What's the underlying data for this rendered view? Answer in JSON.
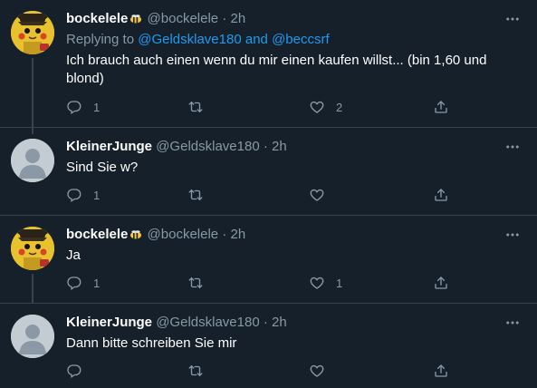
{
  "tweets": [
    {
      "name": "bockelele",
      "handle": "@bockelele",
      "time": "2h",
      "replying_prefix": "Replying to ",
      "replying_user1": "@Geldsklave180",
      "replying_and": " and ",
      "replying_user2": "@beccsrf",
      "text": "Ich brauch auch einen wenn du mir einen kaufen willst... (bin 1,60 und blond)",
      "reply_count": "1",
      "retweet_count": "",
      "like_count": "2"
    },
    {
      "name": "KleinerJunge",
      "handle": "@Geldsklave180",
      "time": "2h",
      "text": "Sind Sie w?",
      "reply_count": "1",
      "retweet_count": "",
      "like_count": ""
    },
    {
      "name": "bockelele",
      "handle": "@bockelele",
      "time": "2h",
      "text": "Ja",
      "reply_count": "1",
      "retweet_count": "",
      "like_count": "1"
    },
    {
      "name": "KleinerJunge",
      "handle": "@Geldsklave180",
      "time": "2h",
      "text": "Dann bitte schreiben Sie mir",
      "reply_count": "",
      "retweet_count": "",
      "like_count": ""
    }
  ],
  "separator": "·",
  "icons": {
    "reply": "reply-icon",
    "retweet": "retweet-icon",
    "like": "heart-icon",
    "share": "share-icon",
    "more": "more-icon",
    "badge": "bee-emoji-icon"
  },
  "colors": {
    "background": "#15202b",
    "muted": "#8899a6",
    "link": "#1d9bf0",
    "divider": "#38444d"
  }
}
